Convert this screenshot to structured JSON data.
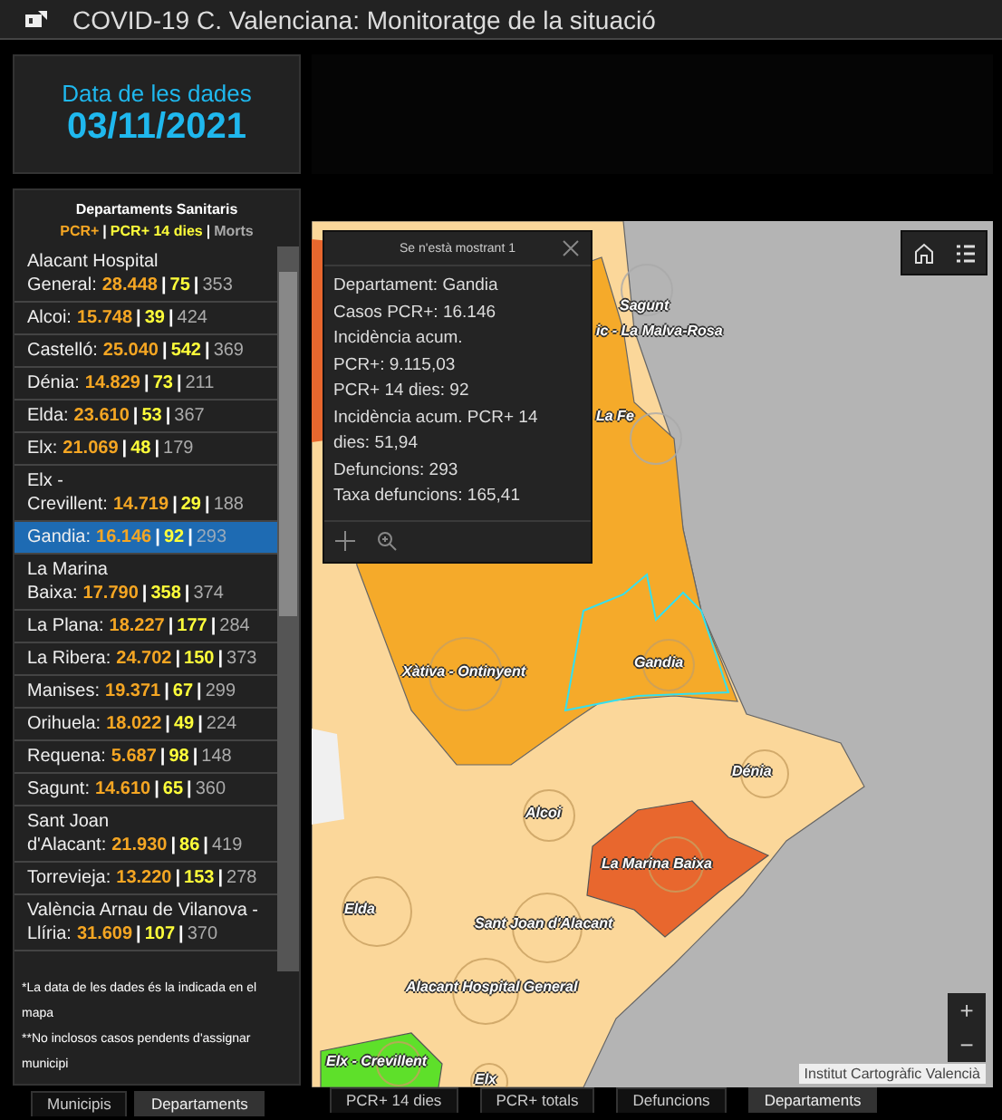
{
  "title": "COVID-19 C. Valenciana: Monitoratge de la situació",
  "date_card": {
    "label": "Data de les dades",
    "value": "03/11/2021"
  },
  "sidebar": {
    "title": "Departaments Sanitaris",
    "legend": [
      {
        "kind": "pcr",
        "text": "PCR+"
      },
      {
        "kind": "separator",
        "text": "|"
      },
      {
        "kind": "pcr14",
        "text": "PCR+ 14 dies"
      },
      {
        "kind": "separator",
        "text": "|"
      },
      {
        "kind": "deaths",
        "text": "Morts"
      }
    ],
    "items": [
      {
        "name": "Alacant Hospital General:",
        "selected": false,
        "parts": [
          {
            "kind": "pcr",
            "text": "28.448"
          },
          {
            "kind": "separator",
            "text": "|"
          },
          {
            "kind": "pcr14",
            "text": "75"
          },
          {
            "kind": "separator",
            "text": "|"
          },
          {
            "kind": "deaths",
            "text": "353"
          }
        ]
      },
      {
        "name": "Alcoi:",
        "selected": false,
        "parts": [
          {
            "kind": "pcr",
            "text": "15.748"
          },
          {
            "kind": "separator",
            "text": "|"
          },
          {
            "kind": "pcr14",
            "text": "39"
          },
          {
            "kind": "separator",
            "text": "|"
          },
          {
            "kind": "deaths",
            "text": "424"
          }
        ]
      },
      {
        "name": "Castelló:",
        "selected": false,
        "parts": [
          {
            "kind": "pcr",
            "text": "25.040"
          },
          {
            "kind": "separator",
            "text": "|"
          },
          {
            "kind": "pcr14",
            "text": "542"
          },
          {
            "kind": "separator",
            "text": "|"
          },
          {
            "kind": "deaths",
            "text": "369"
          }
        ]
      },
      {
        "name": "Dénia:",
        "selected": false,
        "parts": [
          {
            "kind": "pcr",
            "text": "14.829"
          },
          {
            "kind": "separator",
            "text": "|"
          },
          {
            "kind": "pcr14",
            "text": "73"
          },
          {
            "kind": "separator",
            "text": "|"
          },
          {
            "kind": "deaths",
            "text": "211"
          }
        ]
      },
      {
        "name": "Elda:",
        "selected": false,
        "parts": [
          {
            "kind": "pcr",
            "text": "23.610"
          },
          {
            "kind": "separator",
            "text": "|"
          },
          {
            "kind": "pcr14",
            "text": "53"
          },
          {
            "kind": "separator",
            "text": "|"
          },
          {
            "kind": "deaths",
            "text": "367"
          }
        ]
      },
      {
        "name": "Elx:",
        "selected": false,
        "parts": [
          {
            "kind": "pcr",
            "text": "21.069"
          },
          {
            "kind": "separator",
            "text": "|"
          },
          {
            "kind": "pcr14",
            "text": "48"
          },
          {
            "kind": "separator",
            "text": "|"
          },
          {
            "kind": "deaths",
            "text": "179"
          }
        ]
      },
      {
        "name": "Elx - Crevillent:",
        "selected": false,
        "parts": [
          {
            "kind": "pcr",
            "text": "14.719"
          },
          {
            "kind": "separator",
            "text": "|"
          },
          {
            "kind": "pcr14",
            "text": "29"
          },
          {
            "kind": "separator",
            "text": "|"
          },
          {
            "kind": "deaths",
            "text": "188"
          }
        ]
      },
      {
        "name": "Gandia:",
        "selected": true,
        "parts": [
          {
            "kind": "pcr",
            "text": "16.146"
          },
          {
            "kind": "separator",
            "text": "|"
          },
          {
            "kind": "pcr14",
            "text": "92"
          },
          {
            "kind": "separator",
            "text": "|"
          },
          {
            "kind": "deaths",
            "text": "293"
          }
        ]
      },
      {
        "name": "La Marina Baixa:",
        "selected": false,
        "parts": [
          {
            "kind": "pcr",
            "text": "17.790"
          },
          {
            "kind": "separator",
            "text": "|"
          },
          {
            "kind": "pcr14",
            "text": "358"
          },
          {
            "kind": "separator",
            "text": "|"
          },
          {
            "kind": "deaths",
            "text": "374"
          }
        ]
      },
      {
        "name": "La Plana:",
        "selected": false,
        "parts": [
          {
            "kind": "pcr",
            "text": "18.227"
          },
          {
            "kind": "separator",
            "text": "|"
          },
          {
            "kind": "pcr14",
            "text": "177"
          },
          {
            "kind": "separator",
            "text": "|"
          },
          {
            "kind": "deaths",
            "text": "284"
          }
        ]
      },
      {
        "name": "La Ribera:",
        "selected": false,
        "parts": [
          {
            "kind": "pcr",
            "text": "24.702"
          },
          {
            "kind": "separator",
            "text": "|"
          },
          {
            "kind": "pcr14",
            "text": "150"
          },
          {
            "kind": "separator",
            "text": "|"
          },
          {
            "kind": "deaths",
            "text": "373"
          }
        ]
      },
      {
        "name": "Manises:",
        "selected": false,
        "parts": [
          {
            "kind": "pcr",
            "text": "19.371"
          },
          {
            "kind": "separator",
            "text": "|"
          },
          {
            "kind": "pcr14",
            "text": "67"
          },
          {
            "kind": "separator",
            "text": "|"
          },
          {
            "kind": "deaths",
            "text": "299"
          }
        ]
      },
      {
        "name": "Orihuela:",
        "selected": false,
        "parts": [
          {
            "kind": "pcr",
            "text": "18.022"
          },
          {
            "kind": "separator",
            "text": "|"
          },
          {
            "kind": "pcr14",
            "text": "49"
          },
          {
            "kind": "separator",
            "text": "|"
          },
          {
            "kind": "deaths",
            "text": "224"
          }
        ]
      },
      {
        "name": "Requena:",
        "selected": false,
        "parts": [
          {
            "kind": "pcr",
            "text": "5.687"
          },
          {
            "kind": "separator",
            "text": "|"
          },
          {
            "kind": "pcr14",
            "text": "98"
          },
          {
            "kind": "separator",
            "text": "|"
          },
          {
            "kind": "deaths",
            "text": "148"
          }
        ]
      },
      {
        "name": "Sagunt:",
        "selected": false,
        "parts": [
          {
            "kind": "pcr",
            "text": "14.610"
          },
          {
            "kind": "separator",
            "text": "|"
          },
          {
            "kind": "pcr14",
            "text": "65"
          },
          {
            "kind": "separator",
            "text": "|"
          },
          {
            "kind": "deaths",
            "text": "360"
          }
        ]
      },
      {
        "name": "Sant Joan d'Alacant:",
        "selected": false,
        "parts": [
          {
            "kind": "pcr",
            "text": "21.930"
          },
          {
            "kind": "separator",
            "text": "|"
          },
          {
            "kind": "pcr14",
            "text": "86"
          },
          {
            "kind": "separator",
            "text": "|"
          },
          {
            "kind": "deaths",
            "text": "419"
          }
        ]
      },
      {
        "name": "Torrevieja:",
        "selected": false,
        "parts": [
          {
            "kind": "pcr",
            "text": "13.220"
          },
          {
            "kind": "separator",
            "text": "|"
          },
          {
            "kind": "pcr14",
            "text": "153"
          },
          {
            "kind": "separator",
            "text": "|"
          },
          {
            "kind": "deaths",
            "text": "278"
          }
        ]
      },
      {
        "name": "València Arnau de Vilanova - Llíria:",
        "selected": false,
        "parts": [
          {
            "kind": "pcr",
            "text": "31.609"
          },
          {
            "kind": "separator",
            "text": "|"
          },
          {
            "kind": "pcr14",
            "text": "107"
          },
          {
            "kind": "separator",
            "text": "|"
          },
          {
            "kind": "deaths",
            "text": "370"
          }
        ]
      }
    ],
    "notes": [
      "*La data de les dades és la indicada en el mapa",
      "**No inclosos casos pendents d'assignar municipi"
    ]
  },
  "left_tabs": [
    {
      "label": "Municipis",
      "selected": false
    },
    {
      "label": "Departaments",
      "selected": true
    }
  ],
  "map": {
    "popup": {
      "title": "Se n'està mostrant 1",
      "lines": [
        "Departament: Gandia",
        "Casos PCR+: 16.146",
        "Incidència acum.",
        "PCR+: 9.115,03",
        "PCR+ 14 dies: 92",
        "Incidència acum. PCR+ 14",
        "dies: 51,94",
        "Defuncions: 293",
        "Taxa defuncions: 165,41"
      ]
    },
    "labels": [
      "Sagunt",
      "ic - La Malva-Rosa",
      "La Fe",
      "Xàtiva - Ontinyent",
      "Gandia",
      "Dénia",
      "Alcoi",
      "La Marina Baixa",
      "Elda",
      "Sant Joan d'Alacant",
      "Alacant Hospital General",
      "Elx - Crevillent",
      "Elx"
    ],
    "zoom_in": "+",
    "zoom_out": "−",
    "attribution": "Institut Cartogràfic Valencià"
  },
  "bottom_tabs": [
    {
      "label": "PCR+ 14 dies",
      "selected": false
    },
    {
      "label": "PCR+ totals",
      "selected": false
    },
    {
      "label": "Defuncions",
      "selected": false
    },
    {
      "label": "Departaments",
      "selected": true
    }
  ]
}
